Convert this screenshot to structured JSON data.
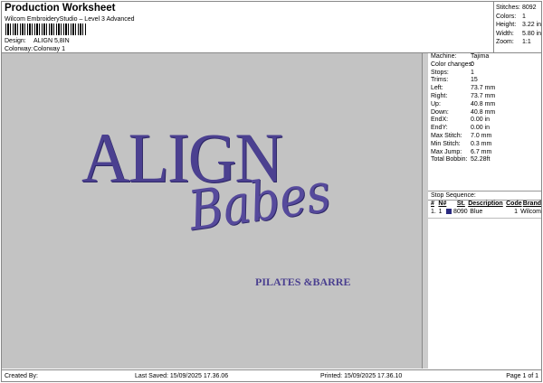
{
  "header": {
    "title": "Production Worksheet",
    "subtitle": "Wilcom EmbroideryStudio – Level 3 Advanced",
    "design_label": "Design:",
    "design_value": "ALIGN 5,8IN",
    "colorway_label": "Colorway:",
    "colorway_value": "Colorway 1"
  },
  "stats": [
    {
      "k": "Stitches:",
      "v": "8092"
    },
    {
      "k": "Colors:",
      "v": "1"
    },
    {
      "k": "Height:",
      "v": "3.22 in"
    },
    {
      "k": "Width:",
      "v": "5.80 in"
    },
    {
      "k": "Zoom:",
      "v": "1:1"
    }
  ],
  "design_art": {
    "line1": "ALIGN",
    "line2": "Babes",
    "line3": "PILATES &BARRE",
    "thread_color": "#4b4090"
  },
  "machine": [
    {
      "k": "Machine:",
      "v": "Tajima"
    },
    {
      "k": "Color changes:",
      "v": "0"
    },
    {
      "k": "Stops:",
      "v": "1"
    },
    {
      "k": "Trims:",
      "v": "15"
    },
    {
      "k": "Left:",
      "v": "73.7 mm"
    },
    {
      "k": "Right:",
      "v": "73.7 mm"
    },
    {
      "k": "Up:",
      "v": "40.8 mm"
    },
    {
      "k": "Down:",
      "v": "40.8 mm"
    },
    {
      "k": "EndX:",
      "v": "0.00 in"
    },
    {
      "k": "EndY:",
      "v": "0.00 in"
    },
    {
      "k": "Max Stitch:",
      "v": "7.0 mm"
    },
    {
      "k": "Min Stitch:",
      "v": "0.3 mm"
    },
    {
      "k": "Max Jump:",
      "v": "6.7 mm"
    },
    {
      "k": "Total Bobbin:",
      "v": "52.28ft"
    }
  ],
  "stop_sequence": {
    "title": "Stop Sequence:",
    "headers": [
      "#",
      "N#",
      "St.",
      "Description",
      "Code",
      "Brand"
    ],
    "rows": [
      {
        "num": "1.",
        "n": "1",
        "st": "8090",
        "desc": "Blue",
        "code": "1",
        "brand": "Wilcom",
        "color": "#2a2a80"
      }
    ]
  },
  "footer": {
    "created": "Created By:",
    "saved": "Last Saved: 15/09/2025 17.36.06",
    "printed": "Printed: 15/09/2025 17.36.10",
    "page": "Page 1 of 1"
  }
}
